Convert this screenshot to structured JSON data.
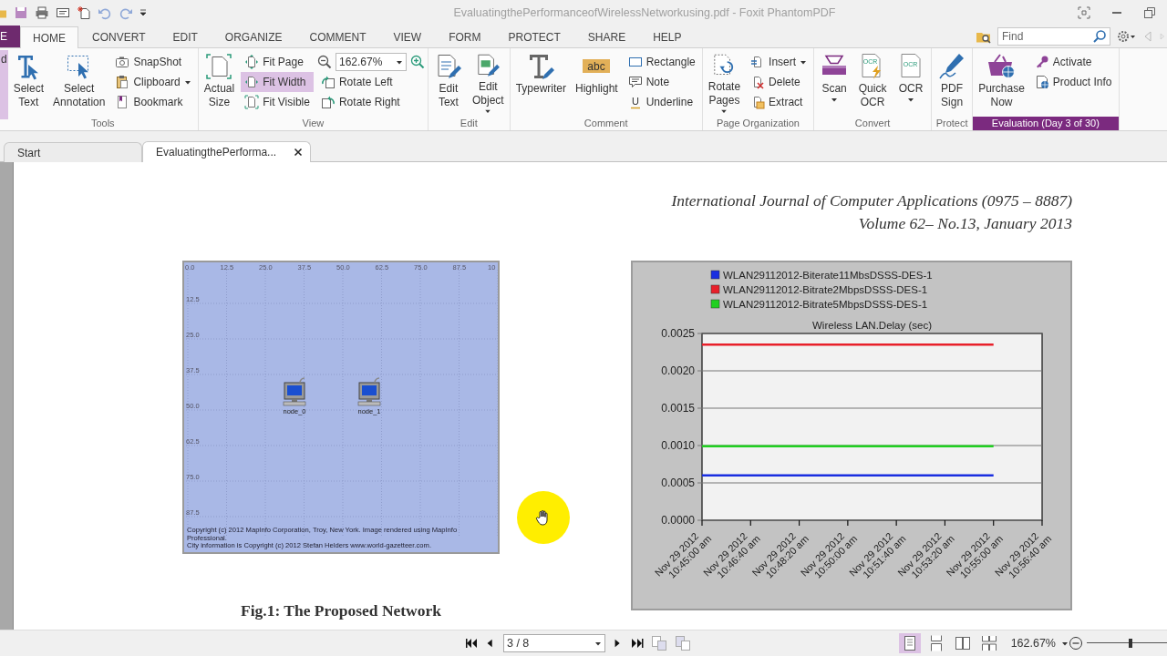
{
  "window": {
    "title": "EvaluatingthePerformanceofWirelessNetworkusing.pdf - Foxit PhantomPDF"
  },
  "ribbon_tabs": [
    {
      "label": "E",
      "kind": "file",
      "selected": false
    },
    {
      "label": "HOME",
      "kind": "tab",
      "selected": true
    },
    {
      "label": "CONVERT",
      "kind": "tab",
      "selected": false
    },
    {
      "label": "EDIT",
      "kind": "tab",
      "selected": false
    },
    {
      "label": "ORGANIZE",
      "kind": "tab",
      "selected": false
    },
    {
      "label": "COMMENT",
      "kind": "tab",
      "selected": false
    },
    {
      "label": "VIEW",
      "kind": "tab",
      "selected": false
    },
    {
      "label": "FORM",
      "kind": "tab",
      "selected": false
    },
    {
      "label": "PROTECT",
      "kind": "tab",
      "selected": false
    },
    {
      "label": "SHARE",
      "kind": "tab",
      "selected": false
    },
    {
      "label": "HELP",
      "kind": "tab",
      "selected": false
    }
  ],
  "find": {
    "placeholder": "Find"
  },
  "ribbon_groups": [
    {
      "kind": "plain",
      "columns": [
        {
          "kind": "large",
          "label": "d",
          "selected": true
        }
      ]
    },
    {
      "kind": "plain",
      "label": "Tools",
      "columns": [
        {
          "kind": "large",
          "label": "Select Text",
          "selected": false
        },
        {
          "kind": "large",
          "label": "Select Annotation",
          "selected": false
        },
        {
          "kind": "stack",
          "items": [
            {
              "kind": "button",
              "label": "SnapShot"
            },
            {
              "kind": "button",
              "label": "Clipboard",
              "dropdown": true
            },
            {
              "kind": "button",
              "label": "Bookmark"
            }
          ]
        }
      ]
    },
    {
      "kind": "plain",
      "label": "View",
      "columns": [
        {
          "kind": "large",
          "label": "Actual Size"
        },
        {
          "kind": "stack",
          "items": [
            {
              "kind": "button",
              "label": "Fit Page",
              "selected": false
            },
            {
              "kind": "button",
              "label": "Fit Width",
              "selected": true
            },
            {
              "kind": "button",
              "label": "Fit Visible",
              "selected": false
            }
          ]
        },
        {
          "kind": "stack",
          "items": [
            {
              "kind": "zoom",
              "value": "162.67%"
            },
            {
              "kind": "button",
              "label": "Rotate Left"
            },
            {
              "kind": "button",
              "label": "Rotate Right"
            }
          ]
        }
      ]
    },
    {
      "kind": "plain",
      "label": "Edit",
      "columns": [
        {
          "kind": "large",
          "label": "Edit Text"
        },
        {
          "kind": "large",
          "label": "Edit Object",
          "dropdown": true
        }
      ]
    },
    {
      "kind": "plain",
      "label": "Comment",
      "columns": [
        {
          "kind": "large",
          "label": "Typewriter"
        },
        {
          "kind": "large",
          "label": "Highlight",
          "icon_text": "abc"
        },
        {
          "kind": "stack",
          "items": [
            {
              "kind": "button",
              "label": "Rectangle"
            },
            {
              "kind": "button",
              "label": "Note"
            },
            {
              "kind": "button",
              "label": "Underline",
              "icon_text": "U"
            }
          ]
        }
      ]
    },
    {
      "kind": "plain",
      "label": "Page Organization",
      "columns": [
        {
          "kind": "large",
          "label": "Rotate Pages",
          "dropdown": true
        },
        {
          "kind": "stack",
          "items": [
            {
              "kind": "button",
              "label": "Insert",
              "dropdown": true
            },
            {
              "kind": "button",
              "label": "Delete"
            },
            {
              "kind": "button",
              "label": "Extract"
            }
          ]
        }
      ]
    },
    {
      "kind": "plain",
      "label": "Convert",
      "columns": [
        {
          "kind": "large",
          "label": "Scan",
          "dropdown": true
        },
        {
          "kind": "large",
          "label": "Quick OCR",
          "icon_text": "OCR"
        },
        {
          "kind": "large",
          "label": "OCR",
          "icon_text": "OCR",
          "dropdown": true
        }
      ]
    },
    {
      "kind": "plain",
      "label": "Protect",
      "columns": [
        {
          "kind": "large",
          "label": "PDF Sign"
        }
      ]
    },
    {
      "kind": "highlight",
      "label": "Evaluation (Day 3 of 30)",
      "columns": [
        {
          "kind": "large",
          "label": "Purchase Now"
        },
        {
          "kind": "stack",
          "items": [
            {
              "kind": "button",
              "label": "Activate"
            },
            {
              "kind": "button",
              "label": "Product Info"
            }
          ]
        }
      ]
    }
  ],
  "doc_tabs": [
    {
      "label": "Start",
      "selected": false,
      "closable": false
    },
    {
      "label": "EvaluatingthePerforma...",
      "selected": true,
      "closable": true
    }
  ],
  "document": {
    "header": [
      "International Journal of Computer Applications (0975 – 8887)",
      "Volume 62– No.13, January 2013"
    ],
    "figure_1": {
      "map": {
        "x_labels": [
          "0.0",
          "12.5",
          "25.0",
          "37.5",
          "50.0",
          "62.5",
          "75.0",
          "87.5",
          "10"
        ],
        "y_labels": [
          "12.5",
          "25.0",
          "37.5",
          "50.0",
          "62.5",
          "75.0",
          "87.5"
        ],
        "nodes": [
          {
            "label": "node_0"
          },
          {
            "label": "node_1"
          }
        ],
        "copyright": [
          "Copyright (c) 2012 MapInfo Corporation, Troy, New York. Image rendered using MapInfo Professional.",
          "City information is Copyright (c) 2012 Stefan Helders www.world-gazetteer.com."
        ]
      },
      "caption": "Fig.1: The Proposed Network"
    },
    "figure_2": {
      "chart_data": {
        "type": "line",
        "title": "Wireless LAN.Delay (sec)",
        "grid": true,
        "legend": true,
        "categories": [
          "Nov 29 2012\n10:45:00 am",
          "Nov 29 2012\n10:46:40 am",
          "Nov 29 2012\n10:48:20 am",
          "Nov 29 2012\n10:50:00 am",
          "Nov 29 2012\n10:51:40 am",
          "Nov 29 2012\n10:53:20 am",
          "Nov 29 2012\n10:55:00 am",
          "Nov 29 2012\n10:56:40 am"
        ],
        "ylim": [
          0,
          0.0025
        ],
        "yticks": [
          {
            "value": 0,
            "label": "0.0000"
          },
          {
            "value": 0.0005,
            "label": "0.0005"
          },
          {
            "value": 0.001,
            "label": "0.0010"
          },
          {
            "value": 0.0015,
            "label": "0.0015"
          },
          {
            "value": 0.002,
            "label": "0.0020"
          },
          {
            "value": 0.0025,
            "label": "0.0025"
          }
        ],
        "series": [
          {
            "name": "WLAN29112012-Biterate11MbsDSSS-DES-1",
            "color": "#1a2ee0",
            "values": [
              0.0006,
              0.0006,
              0.0006,
              0.0006,
              0.0006,
              0.0006,
              0.0006,
              null
            ]
          },
          {
            "name": "WLAN29112012-Bitrate2MbpsDSSS-DES-1",
            "color": "#e8202a",
            "values": [
              0.00235,
              0.00235,
              0.00235,
              0.00235,
              0.00235,
              0.00235,
              0.00235,
              null
            ]
          },
          {
            "name": "WLAN29112012-Bitrate5MbpsDSSS-DES-1",
            "color": "#20d020",
            "values": [
              0.00099,
              0.00099,
              0.00099,
              0.00099,
              0.00099,
              0.00099,
              0.00099,
              null
            ]
          }
        ]
      }
    }
  },
  "status_bar": {
    "page_field": "3 / 8",
    "view_modes": [
      {
        "selected": true
      },
      {
        "selected": false
      },
      {
        "selected": false
      },
      {
        "selected": false
      }
    ],
    "zoom": "162.67%",
    "zoom_slider": {
      "level": 0.55
    }
  }
}
